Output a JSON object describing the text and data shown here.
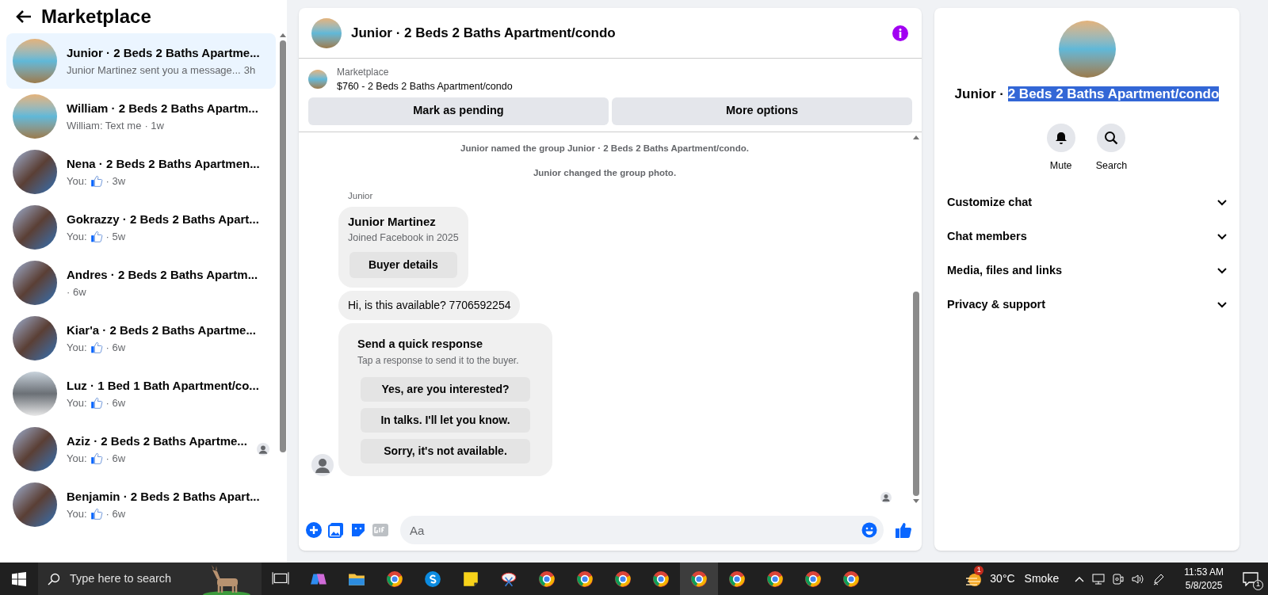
{
  "sidebar": {
    "title": "Marketplace",
    "conversations": [
      {
        "name": "Junior · 2 Beds 2 Baths Apartme...",
        "preview": "Junior Martinez sent you a message...",
        "liked": false,
        "time": "3h",
        "kind": "pool",
        "seen": false,
        "selected": true
      },
      {
        "name": "William · 2 Beds 2 Baths Apartm...",
        "preview": "William: Text me",
        "liked": false,
        "time": "· 1w",
        "kind": "pool",
        "seen": false,
        "selected": false
      },
      {
        "name": "Nena · 2 Beds 2 Baths Apartmen...",
        "preview": "You:",
        "liked": true,
        "time": "· 3w",
        "kind": "building",
        "seen": false,
        "selected": false
      },
      {
        "name": "Gokrazzy · 2 Beds 2 Baths Apart...",
        "preview": "You:",
        "liked": true,
        "time": "· 5w",
        "kind": "building",
        "seen": false,
        "selected": false
      },
      {
        "name": "Andres · 2 Beds 2 Baths Apartm...",
        "liked": false,
        "time": "· 6w",
        "kind": "building",
        "seen": false,
        "selected": false
      },
      {
        "name": "Kiar'a · 2 Beds 2 Baths Apartme...",
        "preview": "You:",
        "liked": true,
        "time": "· 6w",
        "kind": "building",
        "seen": false,
        "selected": false
      },
      {
        "name": "Luz · 1 Bed 1 Bath Apartment/co...",
        "preview": "You:",
        "liked": true,
        "time": "· 6w",
        "kind": "bedroom",
        "seen": false,
        "selected": false
      },
      {
        "name": "Aziz · 2 Beds 2 Baths Apartme...",
        "preview": "You:",
        "liked": true,
        "time": "· 6w",
        "kind": "building",
        "seen": true,
        "selected": false
      },
      {
        "name": "Benjamin · 2 Beds 2 Baths Apart...",
        "preview": "You:",
        "liked": true,
        "time": "· 6w",
        "kind": "building",
        "seen": false,
        "selected": false
      }
    ]
  },
  "chat": {
    "title": "Junior · 2 Beds 2 Baths Apartment/condo",
    "listing": {
      "source": "Marketplace",
      "summary": "$760 - 2 Beds 2 Baths Apartment/condo"
    },
    "actions": [
      "Mark as pending",
      "More options"
    ],
    "events": [
      "Junior named the group Junior · 2 Beds 2 Baths Apartment/condo.",
      "Junior changed the group photo."
    ],
    "sender": "Junior",
    "profile_card": {
      "name": "Junior Martinez",
      "joined": "Joined Facebook in 2025",
      "button": "Buyer details"
    },
    "message": "Hi, is this available? 7706592254",
    "quick_response": {
      "title": "Send a quick response",
      "hint": "Tap a response to send it to the buyer.",
      "options": [
        "Yes, are you interested?",
        "In talks. I'll let you know.",
        "Sorry, it's not available."
      ]
    },
    "composer": {
      "placeholder": "Aa"
    }
  },
  "details": {
    "title": "Junior · ",
    "title_selected": "2 Beds 2 Baths Apartment/condo",
    "buttons": [
      "Mute",
      "Search"
    ],
    "sections": [
      {
        "label": "Customize chat",
        "expanded": false
      },
      {
        "label": "Chat members",
        "expanded": false
      },
      {
        "label": "Media, files and links",
        "expanded": false
      },
      {
        "label": "Privacy & support",
        "expanded": false
      }
    ]
  },
  "taskbar": {
    "search_placeholder": "Type here to search",
    "apps": [
      {
        "kind": "taskview",
        "active": false
      },
      {
        "kind": "copilot",
        "active": false
      },
      {
        "kind": "folder",
        "active": false
      },
      {
        "kind": "chrome",
        "active": false
      },
      {
        "kind": "skype",
        "active": false
      },
      {
        "kind": "notes",
        "active": false
      },
      {
        "kind": "snip",
        "active": false
      },
      {
        "kind": "chrome",
        "active": false
      },
      {
        "kind": "chrome",
        "active": false
      },
      {
        "kind": "chrome",
        "active": false
      },
      {
        "kind": "chrome",
        "active": false
      },
      {
        "kind": "chrome",
        "active": true
      },
      {
        "kind": "chrome",
        "active": false
      },
      {
        "kind": "chrome",
        "active": false
      },
      {
        "kind": "chrome",
        "active": false
      },
      {
        "kind": "chrome",
        "active": false
      }
    ],
    "weather": {
      "badge": "1",
      "temperature": "30°C",
      "condition": "Smoke"
    },
    "time": "11:53 AM",
    "date": "5/8/2025",
    "notifications": "1"
  }
}
